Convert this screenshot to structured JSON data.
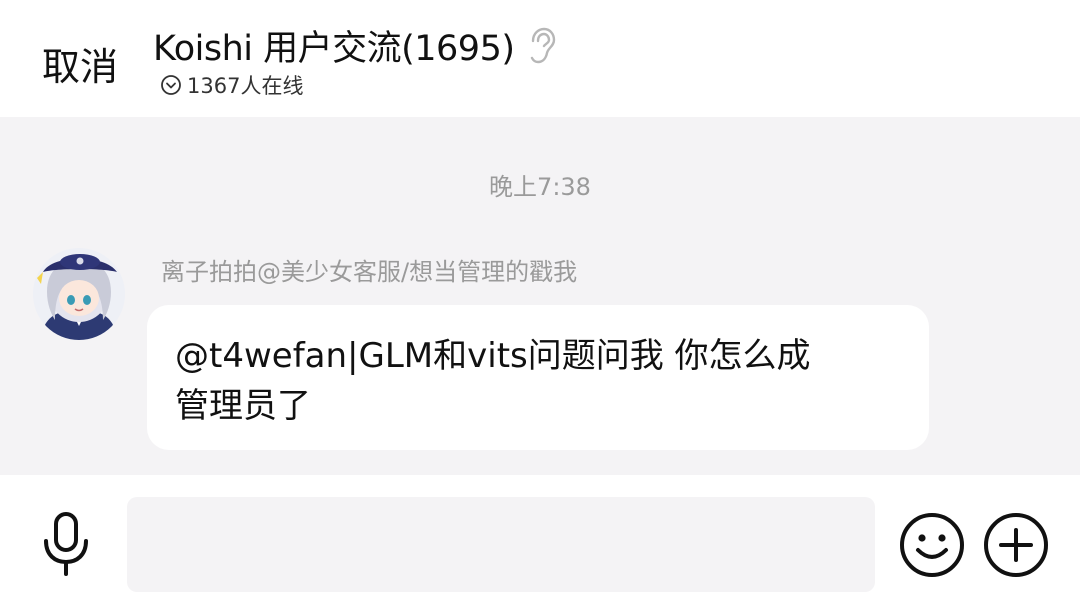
{
  "header": {
    "cancel_label": "取消",
    "title": "Koishi 用户交流(1695)",
    "online_text": "1367人在线"
  },
  "chat": {
    "timestamp": "晚上7:38",
    "messages": [
      {
        "sender": "离子拍拍@美少女客服/想当管理的戳我",
        "text_line1": "@t4wefan|GLM和vits问题问我 你怎么成",
        "text_line2": "管理员了"
      }
    ]
  },
  "composer": {
    "input_value": ""
  },
  "icons": {
    "ear": "ear-icon",
    "online": "chevron-circle-icon",
    "mic": "mic-icon",
    "emoji": "emoji-icon",
    "plus": "plus-circle-icon"
  }
}
